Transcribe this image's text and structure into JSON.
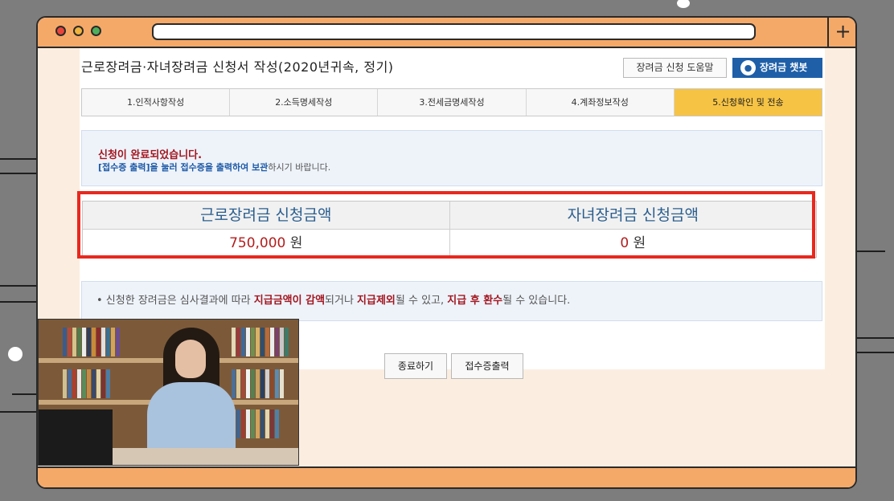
{
  "browser": {
    "new_tab_symbol": "+"
  },
  "page": {
    "title": "근로장려금·자녀장려금 신청서 작성(2020년귀속, 정기)",
    "help_button": "장려금 신청 도움말",
    "chatbot_button": "장려금 챗봇"
  },
  "steps": [
    {
      "label": "1.인적사항작성",
      "active": false
    },
    {
      "label": "2.소득명세작성",
      "active": false
    },
    {
      "label": "3.전세금명세작성",
      "active": false
    },
    {
      "label": "4.계좌정보작성",
      "active": false
    },
    {
      "label": "5.신청확인 및 전송",
      "active": true
    }
  ],
  "notice": {
    "title": "신청이 완료되었습니다.",
    "line_highlight": "[접수증 출력]을 눌러 접수증을 출력하여 보관",
    "line_rest": "하시기 바랍니다."
  },
  "amounts": {
    "headers": [
      "근로장려금 신청금액",
      "자녀장려금 신청금액"
    ],
    "values": [
      "750,000",
      "0"
    ],
    "unit": "원"
  },
  "info": {
    "p1": "• 신청한 장려금은 심사결과에 따라 ",
    "r1": "지급금액이 감액",
    "p2": "되거나 ",
    "r2": "지급제외",
    "p3": "될 수 있고, ",
    "r3": "지급 후 환수",
    "p4": "될 수 있습니다."
  },
  "buttons": {
    "close": "종료하기",
    "print_receipt": "접수증출력"
  },
  "colors": {
    "frame_orange": "#f5a968",
    "highlight_red": "#e8281e",
    "active_step": "#f6c344",
    "chatbot_blue": "#1e5fa8"
  }
}
